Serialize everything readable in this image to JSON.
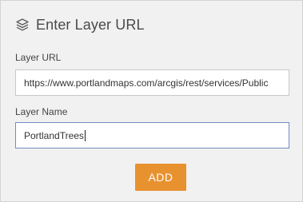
{
  "dialog": {
    "title": "Enter Layer URL",
    "icon": "layers-icon"
  },
  "fields": {
    "url": {
      "label": "Layer URL",
      "value": "https://www.portlandmaps.com/arcgis/rest/services/Public"
    },
    "name": {
      "label": "Layer Name",
      "value": "PortlandTrees"
    }
  },
  "actions": {
    "add_label": "ADD"
  },
  "colors": {
    "panel_bg": "#f1f1f1",
    "accent": "#e8912f",
    "focus_border": "#6f8dbf"
  }
}
